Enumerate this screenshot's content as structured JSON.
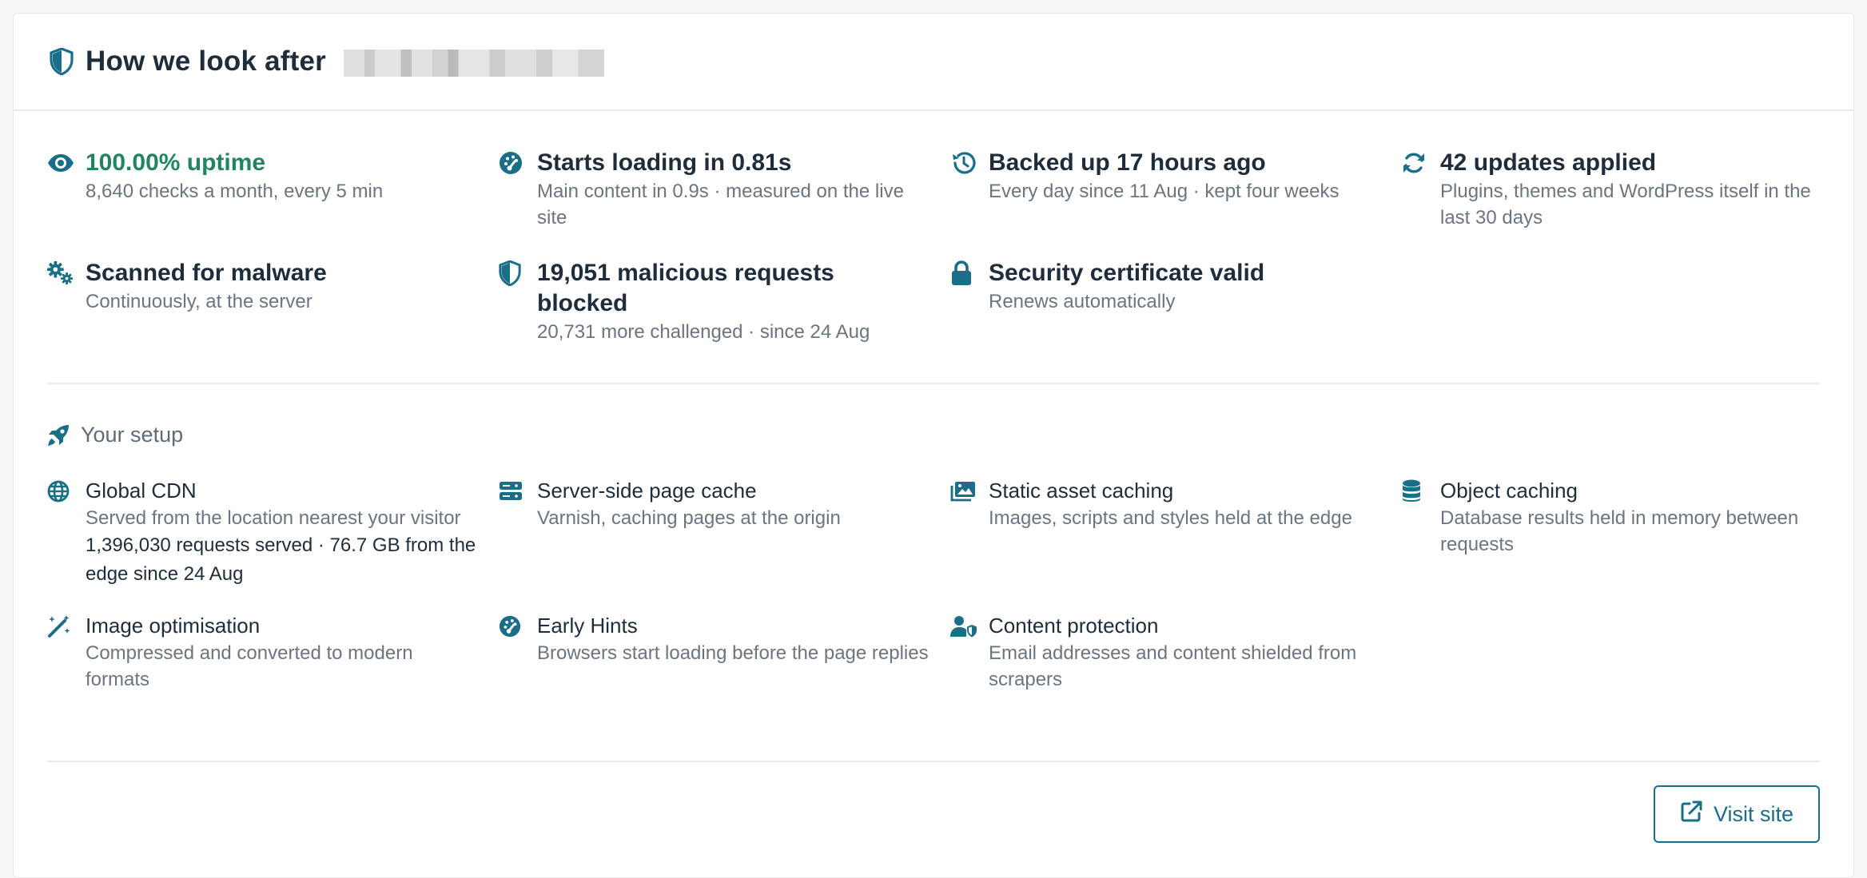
{
  "colors": {
    "accent": "#1b6e87",
    "success": "#23855e",
    "muted": "#6b7580",
    "heading": "#1f2d3a",
    "divider": "#e8ebee"
  },
  "header": {
    "title": "How we look after",
    "icon": "shield-half-icon"
  },
  "metrics": [
    {
      "icon": "eye-icon",
      "title": "100.00% uptime",
      "sub": "8,640 checks a month, every 5 min"
    },
    {
      "icon": "speedometer-icon",
      "title": "Starts loading in 0.81s",
      "sub": "Main content in 0.9s · measured on the live site"
    },
    {
      "icon": "history-icon",
      "title": "Backed up 17 hours ago",
      "sub": "Every day since 11 Aug · kept four weeks"
    },
    {
      "icon": "refresh-icon",
      "title": "42 updates applied",
      "sub": "Plugins, themes and WordPress itself in the last 30 days"
    },
    {
      "icon": "gears-icon",
      "title": "Scanned for malware",
      "sub": "Continuously, at the server"
    },
    {
      "icon": "shield-half-icon",
      "title": "19,051 malicious requests blocked",
      "sub": "20,731 more challenged · since 24 Aug"
    },
    {
      "icon": "lock-icon",
      "title": "Security certificate valid",
      "sub": "Renews automatically"
    }
  ],
  "setup": {
    "heading": "Your setup",
    "icon": "rocket-icon",
    "features": [
      {
        "icon": "globe-icon",
        "title": "Global CDN",
        "sub": "Served from the location nearest your visitor",
        "extra": "1,396,030 requests served · 76.7 GB from the edge since 24 Aug"
      },
      {
        "icon": "server-icon",
        "title": "Server-side page cache",
        "sub": "Varnish, caching pages at the origin"
      },
      {
        "icon": "images-icon",
        "title": "Static asset caching",
        "sub": "Images, scripts and styles held at the edge"
      },
      {
        "icon": "database-icon",
        "title": "Object caching",
        "sub": "Database results held in memory between requests"
      },
      {
        "icon": "magic-wand-icon",
        "title": "Image optimisation",
        "sub": "Compressed and converted to modern formats"
      },
      {
        "icon": "speedometer-icon",
        "title": "Early Hints",
        "sub": "Browsers start loading before the page replies"
      },
      {
        "icon": "user-shield-icon",
        "title": "Content protection",
        "sub": "Email addresses and content shielded from scrapers"
      }
    ]
  },
  "actions": {
    "visit_label": "Visit site",
    "visit_icon": "external-link-icon"
  }
}
